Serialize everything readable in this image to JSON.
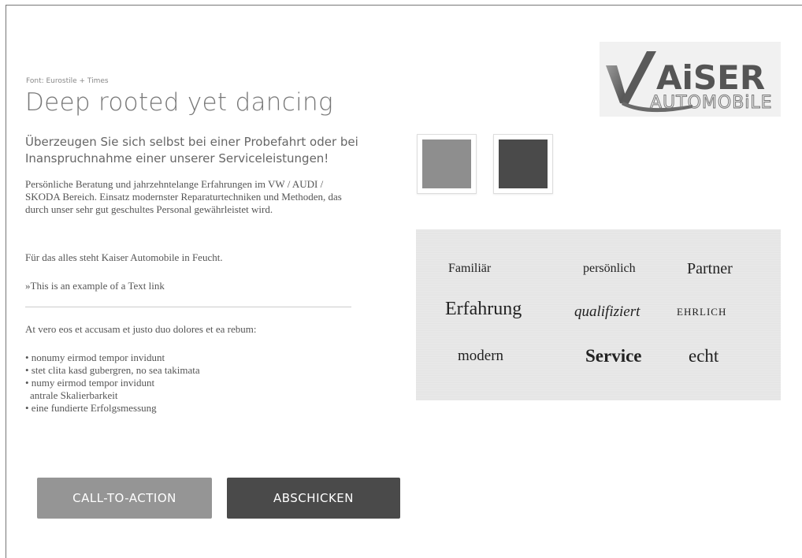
{
  "font_note": "Font: Eurostile + Times",
  "headline": "Deep rooted yet dancing",
  "subhead": "Überzeugen Sie sich selbst bei einer Probefahrt oder bei Inanspruchnahme einer unserer Serviceleistungen!",
  "paragraph_1": "Persönliche Beratung und jahrzehntelange Erfahrungen im VW / AUDI / SKODA Bereich. Einsatz modernster Reparaturtechniken und Methoden, das durch unser sehr gut geschultes Personal gewährleistet wird.",
  "paragraph_2": "Für das alles steht Kaiser Automobile in Feucht.",
  "text_link": "»This is an example of a Text link",
  "paragraph_3": "At vero eos et accusam et justo duo dolores et ea rebum:",
  "bullets": [
    "• nonumy eirmod tempor invidunt",
    "• stet clita kasd gubergren, no sea takimata",
    "• numy eirmod tempor invidunt",
    "antrale Skalierbarkeit",
    "• eine fundierte Erfolgsmessung"
  ],
  "buttons": {
    "cta_label": "CALL-TO-ACTION",
    "submit_label": "ABSCHICKEN"
  },
  "logo": {
    "brand_text": "KAiSER AUTOMOBiLE",
    "top_word": "AiSER",
    "bottom_word": "AUTOMOBiLE"
  },
  "swatches": {
    "light": "#8e8e8e",
    "dark": "#4a4a4a"
  },
  "word_cloud": [
    "Familiär",
    "persönlich",
    "Partner",
    "Erfahrung",
    "qualifiziert",
    "EHRLICH",
    "modern",
    "Service",
    "echt"
  ]
}
